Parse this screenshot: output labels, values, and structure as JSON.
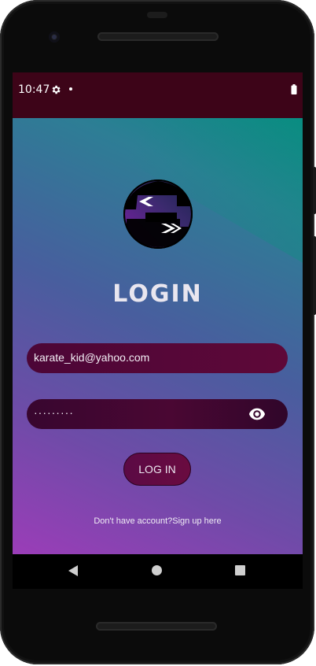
{
  "status_bar": {
    "time": "10:47",
    "icons": [
      "gear-icon",
      "dot-icon",
      "battery-icon"
    ]
  },
  "login": {
    "title": "LOGIN",
    "email_value": "karate_kid@yahoo.com",
    "password_value": "·········",
    "password_visibility_icon": "eye-icon",
    "button_label": "LOG IN",
    "signup_text": "Don't have account?Sign up here"
  },
  "nav_bar": {
    "icons": [
      "back-icon",
      "home-icon",
      "recents-icon"
    ]
  },
  "colors": {
    "status_bar": "#3d0418",
    "gradient_top": "#0b8b83",
    "gradient_bottom": "#9b3db8",
    "field_bg": "#4c0637",
    "button_bg": "#5b0a45"
  }
}
